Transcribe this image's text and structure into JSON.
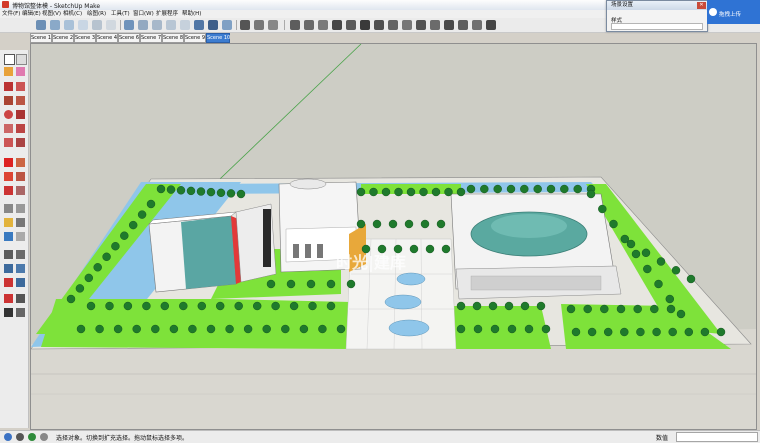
{
  "window": {
    "title": "博物馆整体模 - SketchUp Make",
    "min_label": "—",
    "max_label": "▢",
    "close_label": "✕"
  },
  "menu": [
    "文件(F)",
    "编辑(E)",
    "视图(V)",
    "相机(C)",
    "绘图(R)",
    "工具(T)",
    "窗口(W)",
    "扩展程序",
    "帮助(H)"
  ],
  "scenes": {
    "tabs": [
      "Scene 1",
      "Scene 2",
      "Scene 3",
      "Scene 4",
      "Scene 6",
      "Scene 7",
      "Scene 8",
      "Scene 9",
      "Scene 10"
    ],
    "active_index": 8
  },
  "scene_panel": {
    "title": "场景设置",
    "close_label": "✕",
    "field_label": "样式"
  },
  "upload_button": {
    "label": "拖拽上传"
  },
  "status": {
    "message": "选择对象。切换到扩充选择。拖动鼠标选择多项。",
    "value_label": "数值"
  },
  "watermark": "时光|建库",
  "colors": {
    "sky": "#cfd0c8",
    "ground": "#d8d6cf",
    "grass": "#7ee23a",
    "water": "#8fc6ea",
    "tree": "#1e7a2a",
    "tab_active": "#3c7cd0"
  }
}
